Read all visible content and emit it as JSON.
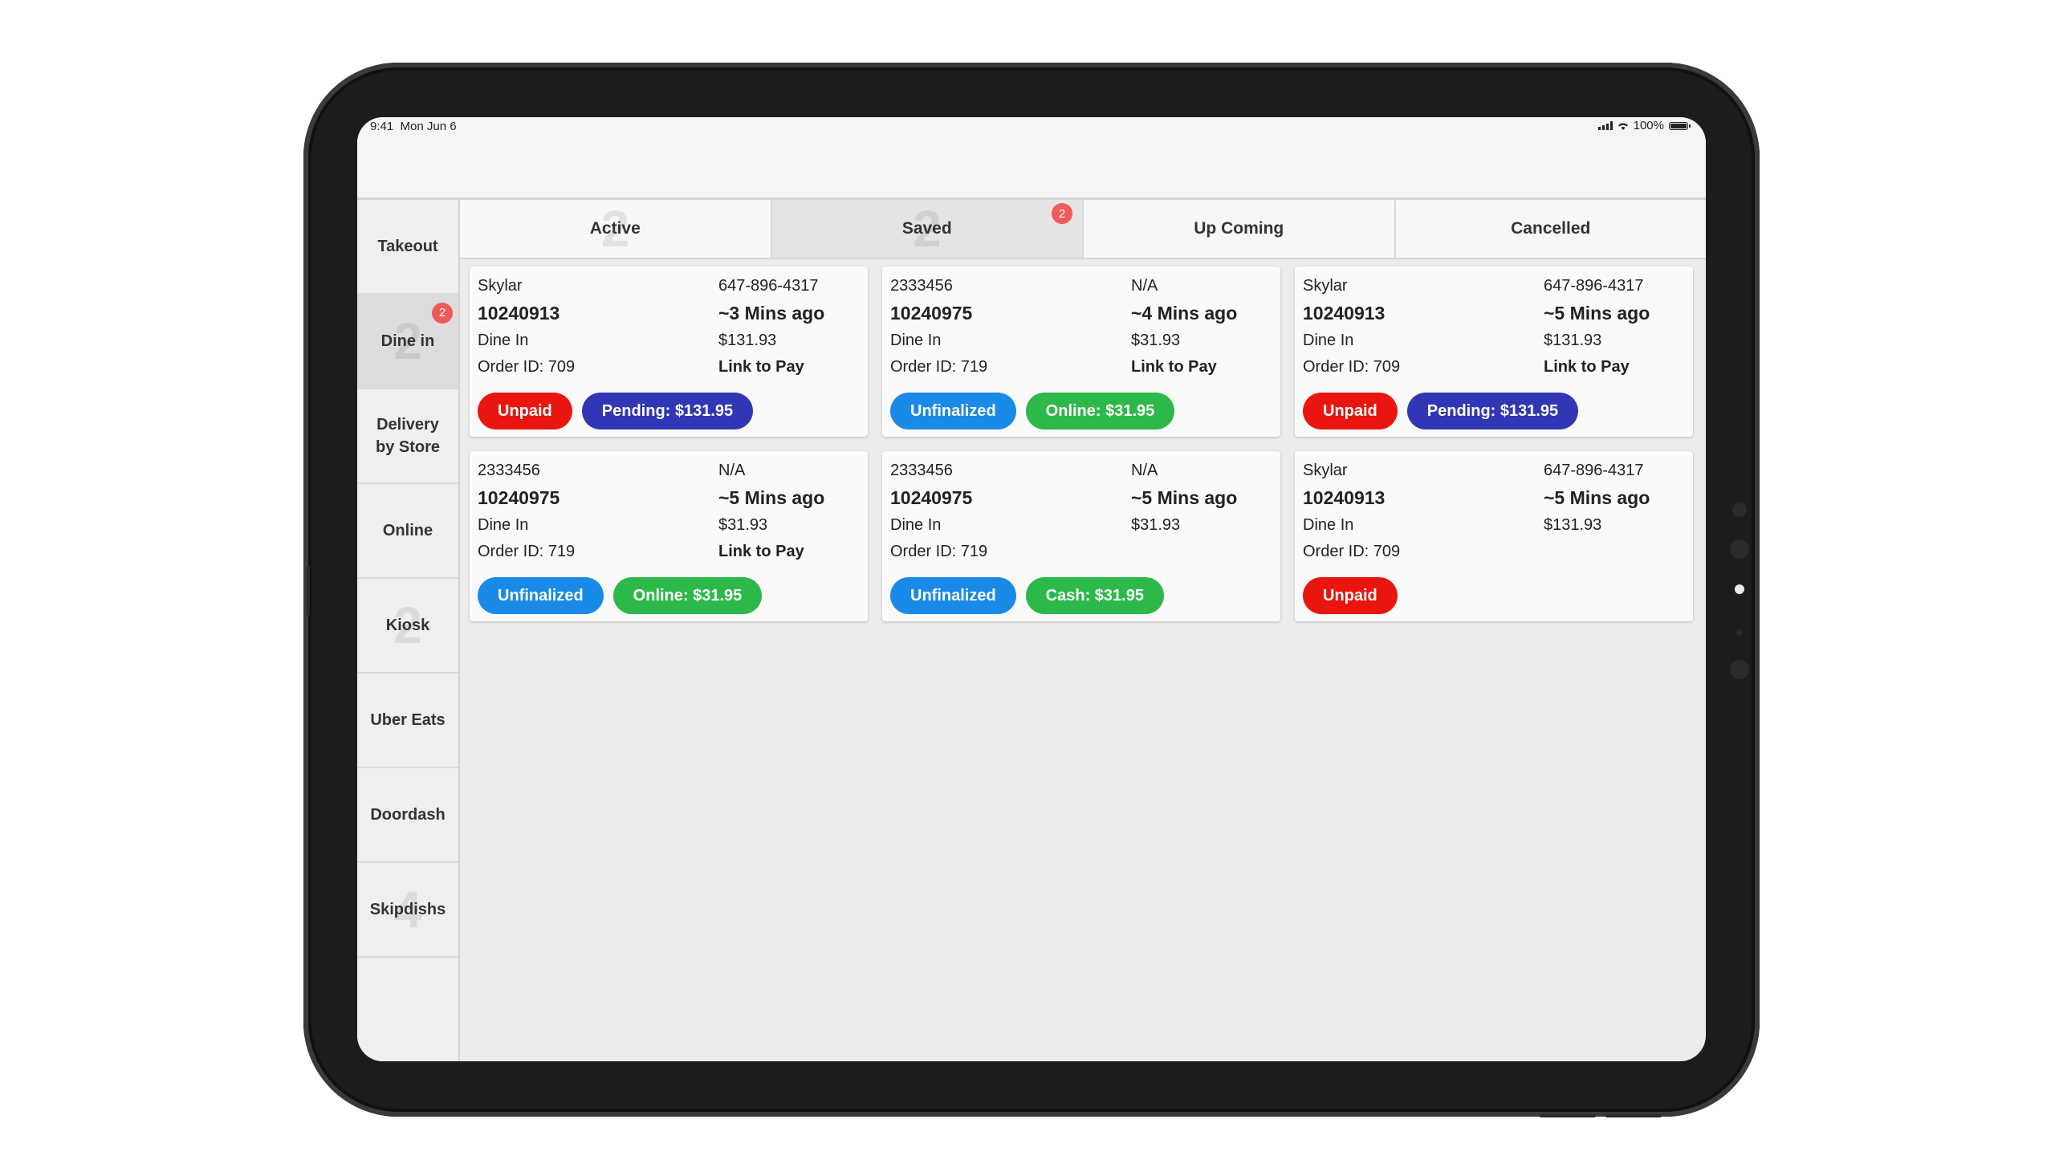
{
  "status_bar": {
    "time": "9:41",
    "date": "Mon Jun 6",
    "battery": "100%"
  },
  "sidebar": {
    "items": [
      {
        "label": "Takeout",
        "ghost": "",
        "badge": ""
      },
      {
        "label": "Dine in",
        "ghost": "2",
        "badge": "2"
      },
      {
        "label": "Delivery\nby Store",
        "ghost": "",
        "badge": ""
      },
      {
        "label": "Online",
        "ghost": "",
        "badge": ""
      },
      {
        "label": "Kiosk",
        "ghost": "2",
        "badge": ""
      },
      {
        "label": "Uber Eats",
        "ghost": "",
        "badge": ""
      },
      {
        "label": "Doordash",
        "ghost": "",
        "badge": ""
      },
      {
        "label": "Skipdishs",
        "ghost": "4",
        "badge": ""
      }
    ],
    "active_index": 1
  },
  "tabs": {
    "items": [
      {
        "label": "Active",
        "ghost": "2",
        "badge": ""
      },
      {
        "label": "Saved",
        "ghost": "2",
        "badge": "2"
      },
      {
        "label": "Up Coming",
        "ghost": "",
        "badge": ""
      },
      {
        "label": "Cancelled",
        "ghost": "",
        "badge": ""
      }
    ],
    "active_index": 1
  },
  "orders": [
    {
      "name": "Skylar",
      "phone": "647-896-4317",
      "number": "10240913",
      "time_ago": "~3 Mins ago",
      "type": "Dine In",
      "amount": "$131.93",
      "order_id": "Order ID: 709",
      "link": "Link to Pay",
      "pills": [
        {
          "text": "Unpaid",
          "style": "red"
        },
        {
          "text": "Pending: $131.95",
          "style": "navy"
        }
      ]
    },
    {
      "name": "2333456",
      "phone": "N/A",
      "number": "10240975",
      "time_ago": "~4 Mins ago",
      "type": "Dine In",
      "amount": "$31.93",
      "order_id": "Order ID: 719",
      "link": "Link to Pay",
      "pills": [
        {
          "text": "Unfinalized",
          "style": "blue"
        },
        {
          "text": "Online: $31.95",
          "style": "green"
        }
      ]
    },
    {
      "name": "Skylar",
      "phone": "647-896-4317",
      "number": "10240913",
      "time_ago": "~5 Mins ago",
      "type": "Dine In",
      "amount": "$131.93",
      "order_id": "Order ID: 709",
      "link": "Link to Pay",
      "pills": [
        {
          "text": "Unpaid",
          "style": "red"
        },
        {
          "text": "Pending: $131.95",
          "style": "navy"
        }
      ]
    },
    {
      "name": "2333456",
      "phone": "N/A",
      "number": "10240975",
      "time_ago": "~5 Mins ago",
      "type": "Dine In",
      "amount": "$31.93",
      "order_id": "Order ID: 719",
      "link": "Link to Pay",
      "pills": [
        {
          "text": "Unfinalized",
          "style": "blue"
        },
        {
          "text": "Online: $31.95",
          "style": "green"
        }
      ]
    },
    {
      "name": "2333456",
      "phone": "N/A",
      "number": "10240975",
      "time_ago": "~5 Mins ago",
      "type": "Dine In",
      "amount": "$31.93",
      "order_id": "Order ID: 719",
      "link": "",
      "pills": [
        {
          "text": "Unfinalized",
          "style": "blue"
        },
        {
          "text": "Cash: $31.95",
          "style": "green"
        }
      ]
    },
    {
      "name": "Skylar",
      "phone": "647-896-4317",
      "number": "10240913",
      "time_ago": "~5 Mins ago",
      "type": "Dine In",
      "amount": "$131.93",
      "order_id": "Order ID: 709",
      "link": "",
      "pills": [
        {
          "text": "Unpaid",
          "style": "red"
        }
      ]
    }
  ],
  "colors": {
    "red": "#e8160e",
    "navy": "#3136b6",
    "blue": "#1a8ae8",
    "green": "#2db84a",
    "badge": "#f05a5a"
  }
}
